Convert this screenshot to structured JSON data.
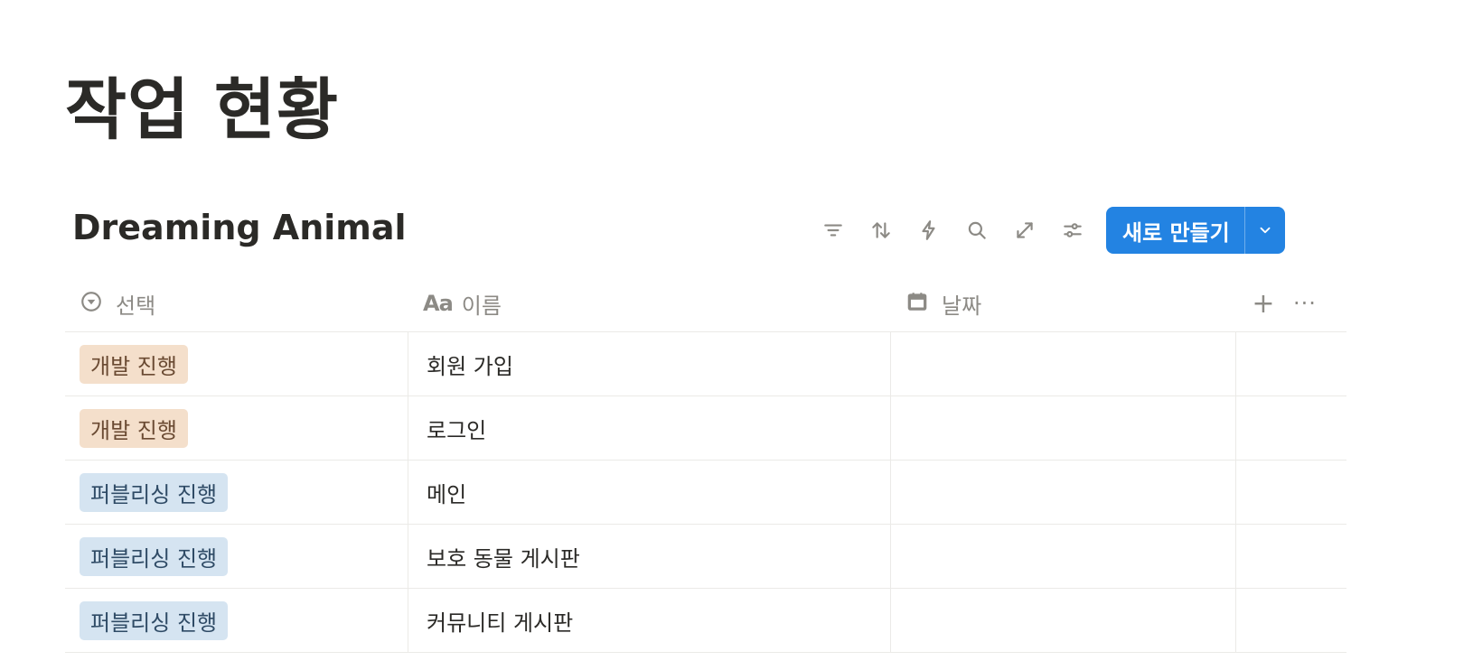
{
  "page": {
    "title": "작업 현황"
  },
  "database": {
    "title": "Dreaming Animal",
    "toolbar": {
      "icons": [
        "filter-icon",
        "sort-icon",
        "automation-icon",
        "search-icon",
        "expand-icon",
        "settings-icon"
      ],
      "new_button_label": "새로 만들기",
      "accent_color": "#2383e2"
    },
    "columns": [
      {
        "label": "선택",
        "icon": "select-icon"
      },
      {
        "label": "이름",
        "icon": "Aa"
      },
      {
        "label": "날짜",
        "icon": "calendar-icon"
      }
    ],
    "header_actions": {
      "add": "+",
      "more": "···"
    },
    "status_colors": {
      "dev": {
        "bg": "#f4dfcb",
        "fg": "#6a4a32"
      },
      "publish": {
        "bg": "#d5e4f1",
        "fg": "#2f4b66"
      },
      "design": {
        "bg": "#fbdcdc",
        "fg": "#6c2a2a"
      }
    },
    "rows": [
      {
        "status": "개발 진행",
        "status_type": "dev",
        "name": "회원 가입",
        "date": ""
      },
      {
        "status": "개발 진행",
        "status_type": "dev",
        "name": "로그인",
        "date": ""
      },
      {
        "status": "퍼블리싱 진행",
        "status_type": "publish",
        "name": "메인",
        "date": ""
      },
      {
        "status": "퍼블리싱 진행",
        "status_type": "publish",
        "name": "보호 동물 게시판",
        "date": ""
      },
      {
        "status": "퍼블리싱 진행",
        "status_type": "publish",
        "name": "커뮤니티 게시판",
        "date": ""
      }
    ]
  }
}
